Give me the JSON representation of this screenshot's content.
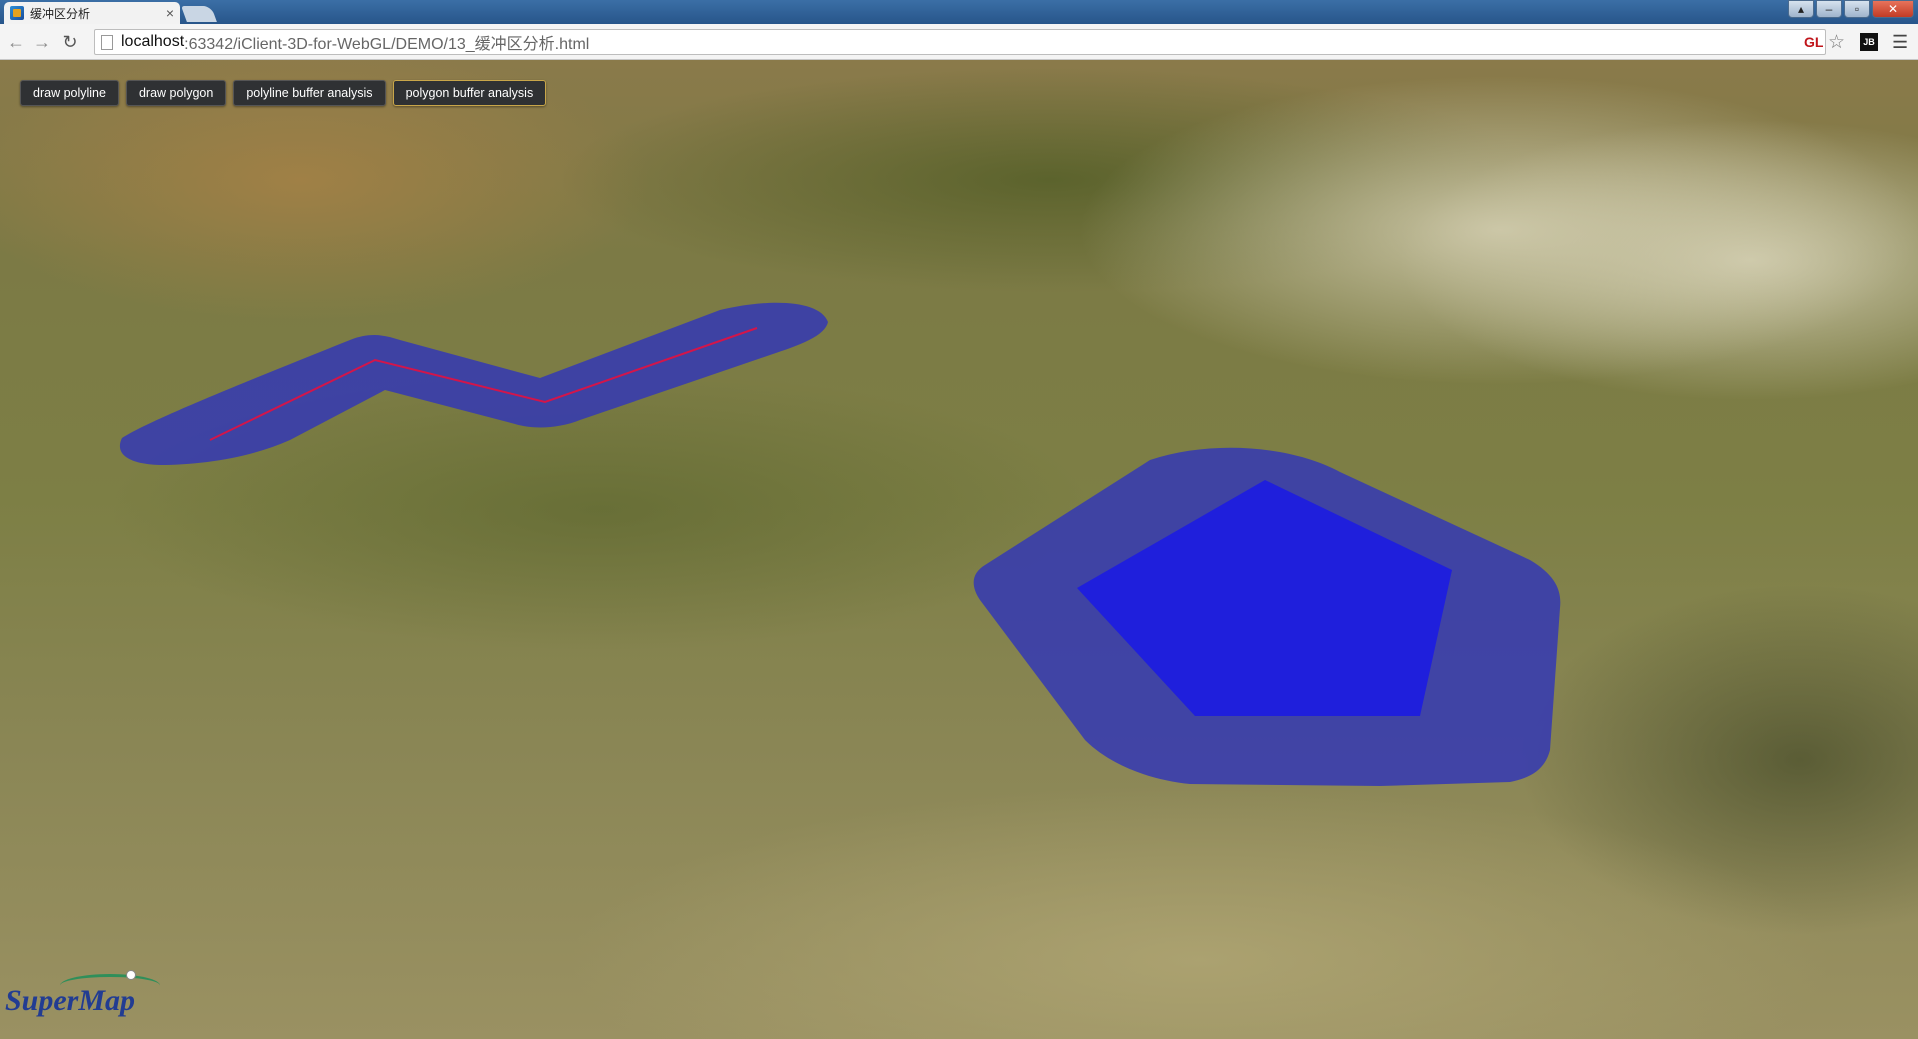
{
  "browser": {
    "tab_title": "缓冲区分析",
    "tab_close": "×",
    "url_host": "localhost",
    "url_rest": ":63342/iClient-3D-for-WebGL/DEMO/13_缓冲区分析.html",
    "extension_gl": "GL",
    "extension_jb": "JB"
  },
  "toolbar": {
    "buttons": [
      {
        "label": "draw polyline"
      },
      {
        "label": "draw polygon"
      },
      {
        "label": "polyline buffer analysis"
      },
      {
        "label": "polygon buffer analysis"
      }
    ]
  },
  "map": {
    "logo_text": "SuperMap",
    "colors": {
      "buffer_fill": "#3438b4",
      "polygon_fill": "#1f1fdc",
      "polyline_stroke": "#d3154a"
    }
  },
  "icons": [
    "back-icon",
    "forward-icon",
    "reload-icon",
    "page-icon",
    "star-icon",
    "menu-icon",
    "close-icon"
  ]
}
